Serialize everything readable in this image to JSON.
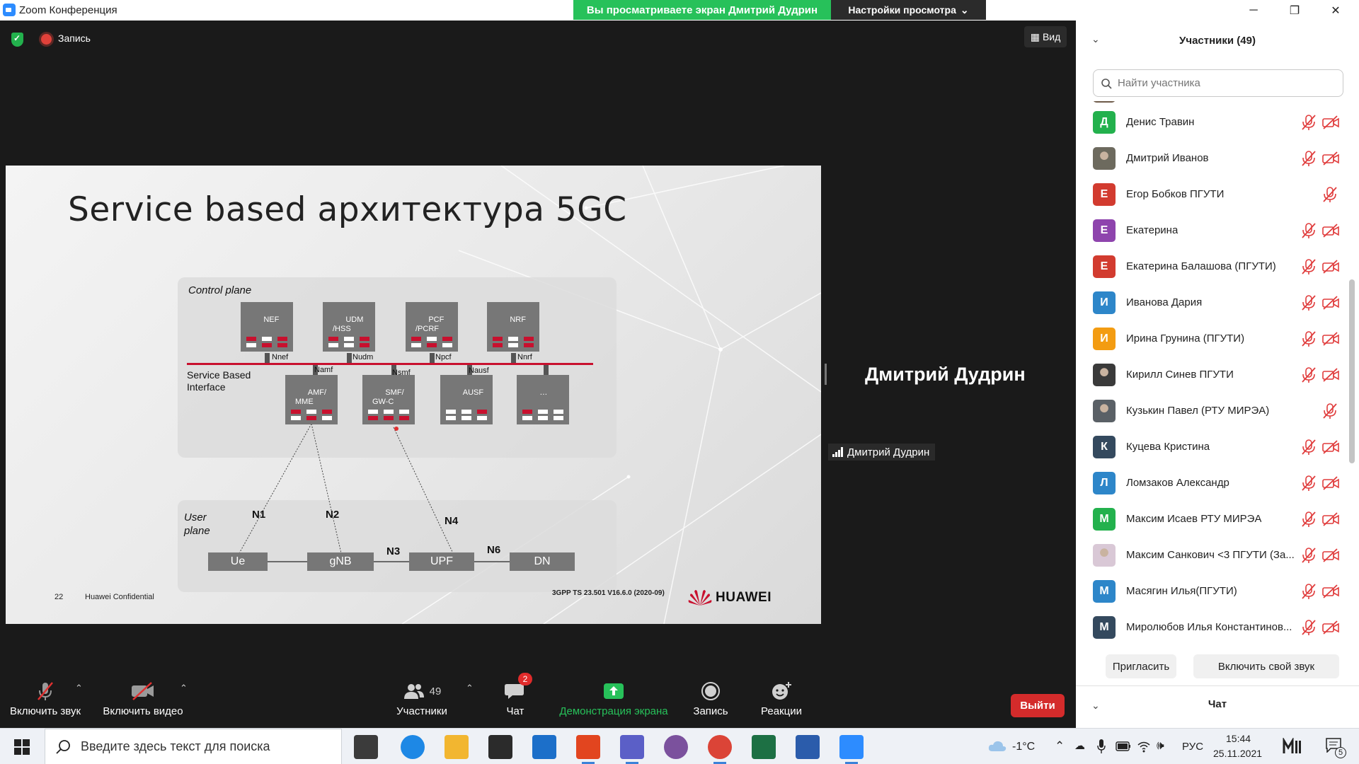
{
  "window": {
    "app_title": "Zoom Конференция",
    "share_banner": "Вы просматриваете экран Дмитрий Дудрин",
    "view_options": "Настройки просмотра",
    "minimize": "─",
    "maximize": "❐",
    "close": "✕"
  },
  "meeting": {
    "record_label": "Запись",
    "view_label": "Вид",
    "speaker_name": "Дмитрий Дудрин",
    "speaker_tag": "Дмитрий Дудрин"
  },
  "slide": {
    "title": "Service based архитектура 5GC",
    "control_plane": "Control plane",
    "user_plane": "User\nplane",
    "sbi_label": "Service Based\nInterface",
    "cp_nodes": [
      {
        "name": "NEF",
        "iface": "Nnef"
      },
      {
        "name": "UDM\n/HSS",
        "iface": "Nudm"
      },
      {
        "name": "PCF\n/PCRF",
        "iface": "Npcf"
      },
      {
        "name": "NRF",
        "iface": "Nnrf"
      }
    ],
    "cp_nodes_bottom": [
      {
        "name": "AMF/\nMME",
        "iface": "Namf"
      },
      {
        "name": "SMF/\nGW-C",
        "iface": "Nsmf"
      },
      {
        "name": "AUSF",
        "iface": "Nausf"
      },
      {
        "name": "…",
        "iface": ""
      }
    ],
    "up_nodes": [
      "Ue",
      "gNB",
      "UPF",
      "DN"
    ],
    "n_labels": [
      "N1",
      "N2",
      "N4",
      "N3",
      "N6"
    ],
    "page_number": "22",
    "confidential": "Huawei Confidential",
    "reference": "3GPP TS 23.501 V16.6.0 (2020-09)",
    "brand": "HUAWEI",
    "led_colors": {
      "red": "#c8102e",
      "white": "#ffffff"
    }
  },
  "toolbar": {
    "audio_label": "Включить звук",
    "video_label": "Включить видео",
    "participants_label": "Участники",
    "participants_count": "49",
    "chat_label": "Чат",
    "chat_badge": "2",
    "share_label": "Демонстрация экрана",
    "record_label": "Запись",
    "reactions_label": "Реакции",
    "leave_label": "Выйти",
    "share_color": "#27c15a"
  },
  "panel": {
    "title": "Участники (49)",
    "search_placeholder": "Найти участника",
    "participants": [
      {
        "name": "Денис Травин",
        "initial": "Д",
        "color": "#23b14d",
        "photo": false,
        "mic_off": true,
        "cam_off": true
      },
      {
        "name": "Дмитрий Иванов",
        "initial": "",
        "color": "#6d6a5e",
        "photo": true,
        "mic_off": true,
        "cam_off": true
      },
      {
        "name": "Егор Бобков ПГУТИ",
        "initial": "Е",
        "color": "#d23b2f",
        "photo": false,
        "mic_off": true,
        "cam_off": false
      },
      {
        "name": "Екатерина",
        "initial": "Е",
        "color": "#8e44ad",
        "photo": false,
        "mic_off": true,
        "cam_off": true
      },
      {
        "name": "Екатерина Балашова (ПГУТИ)",
        "initial": "Е",
        "color": "#d23b2f",
        "photo": false,
        "mic_off": true,
        "cam_off": true
      },
      {
        "name": "Иванова Дария",
        "initial": "И",
        "color": "#2d86c9",
        "photo": false,
        "mic_off": true,
        "cam_off": true
      },
      {
        "name": "Ирина Грунина (ПГУТИ)",
        "initial": "И",
        "color": "#f39c12",
        "photo": false,
        "mic_off": true,
        "cam_off": true
      },
      {
        "name": "Кирилл Синев ПГУТИ",
        "initial": "",
        "color": "#3a3a3a",
        "photo": true,
        "mic_off": true,
        "cam_off": true
      },
      {
        "name": "Кузькин Павел (РТУ МИРЭА)",
        "initial": "",
        "color": "#5a6066",
        "photo": true,
        "mic_off": true,
        "cam_off": false
      },
      {
        "name": "Куцева Кристина",
        "initial": "К",
        "color": "#34495e",
        "photo": false,
        "mic_off": true,
        "cam_off": true
      },
      {
        "name": "Ломзаков Александр",
        "initial": "Л",
        "color": "#2d86c9",
        "photo": false,
        "mic_off": true,
        "cam_off": true
      },
      {
        "name": "Максим Исаев РТУ МИРЭА",
        "initial": "М",
        "color": "#23b14d",
        "photo": false,
        "mic_off": true,
        "cam_off": true
      },
      {
        "name": "Максим Санкович <3 ПГУТИ (За...",
        "initial": "",
        "color": "#d9c8d6",
        "photo": true,
        "mic_off": true,
        "cam_off": true
      },
      {
        "name": "Масягин Илья(ПГУТИ)",
        "initial": "М",
        "color": "#2d86c9",
        "photo": false,
        "mic_off": true,
        "cam_off": true
      },
      {
        "name": "Миролюбов Илья Константинов...",
        "initial": "М",
        "color": "#34495e",
        "photo": false,
        "mic_off": true,
        "cam_off": true
      }
    ],
    "invite_label": "Пригласить",
    "unmute_label": "Включить свой звук",
    "chat_title": "Чат"
  },
  "taskbar": {
    "search_placeholder": "Введите здесь текст для поиска",
    "weather": "-1°C",
    "language": "РУС",
    "time": "15:44",
    "date": "25.11.2021",
    "notifications": "5",
    "apps": [
      {
        "name": "task-view",
        "color": "#3b3b3b"
      },
      {
        "name": "edge",
        "color": "#1e88e5"
      },
      {
        "name": "file-explorer",
        "color": "#f2b630"
      },
      {
        "name": "store",
        "color": "#2b2b2b"
      },
      {
        "name": "mail",
        "color": "#1c6fc9"
      },
      {
        "name": "office",
        "color": "#e2451f"
      },
      {
        "name": "teams",
        "color": "#5b5fc7"
      },
      {
        "name": "viber",
        "color": "#7b519d"
      },
      {
        "name": "chrome",
        "color": "#db4437"
      },
      {
        "name": "excel",
        "color": "#1d7044"
      },
      {
        "name": "word",
        "color": "#2b5cab"
      },
      {
        "name": "zoom",
        "color": "#2d8cff"
      }
    ]
  }
}
